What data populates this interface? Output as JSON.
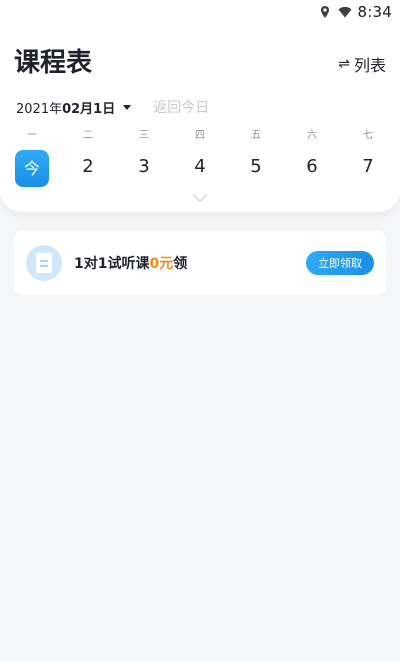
{
  "status_bar": {
    "time": "8:34",
    "icons": [
      "location-icon",
      "wifi-icon"
    ]
  },
  "header": {
    "title": "课程表",
    "list_toggle_label": "列表",
    "list_toggle_icon": "⇌"
  },
  "date_picker": {
    "year": "2021年",
    "month_day": "02月1日",
    "back_today": "返回今日"
  },
  "week": [
    {
      "weekday": "一",
      "label": "今",
      "today": true
    },
    {
      "weekday": "二",
      "label": "2"
    },
    {
      "weekday": "三",
      "label": "3"
    },
    {
      "weekday": "四",
      "label": "4"
    },
    {
      "weekday": "五",
      "label": "5"
    },
    {
      "weekday": "六",
      "label": "6"
    },
    {
      "weekday": "七",
      "label": "7"
    }
  ],
  "promo": {
    "text_prefix": "1对1试听课",
    "text_highlight": "0元",
    "text_suffix": "领",
    "button_label": "立即领取"
  },
  "colors": {
    "accent": "#1a90e6",
    "highlight": "#f08c1a",
    "background": "#f5f6f8"
  }
}
